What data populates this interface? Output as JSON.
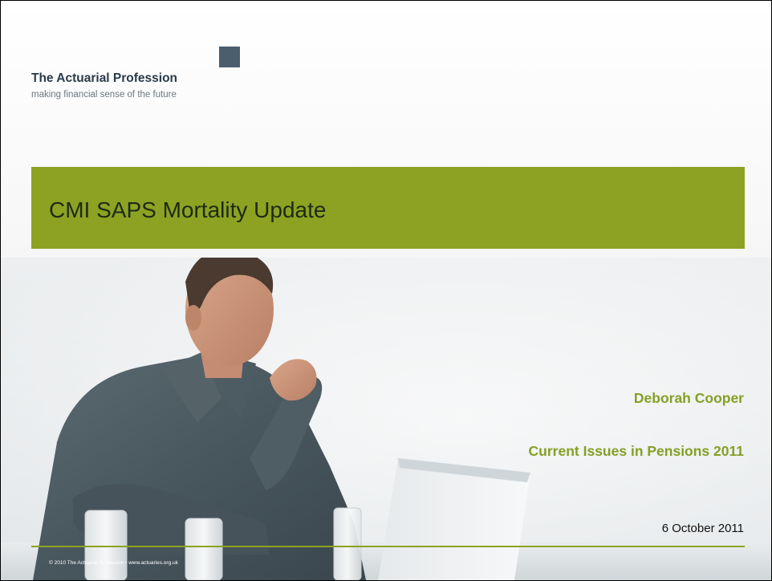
{
  "branding": {
    "org_name": "The Actuarial Profession",
    "tagline": "making financial sense of the future",
    "logo_color": "#4a5e6e"
  },
  "slide": {
    "title": "CMI SAPS Mortality Update",
    "presenter": "Deborah Cooper",
    "event": "Current Issues in Pensions 2011",
    "date": "6 October 2011"
  },
  "footer": {
    "text": "© 2010 The Actuarial Profession • www.actuaries.org.uk"
  },
  "colors": {
    "accent_green": "#8da223",
    "highlight_green": "#85a025",
    "title_text": "#1e2a14"
  },
  "image": {
    "description_icon": "man-at-laptop-photo"
  }
}
